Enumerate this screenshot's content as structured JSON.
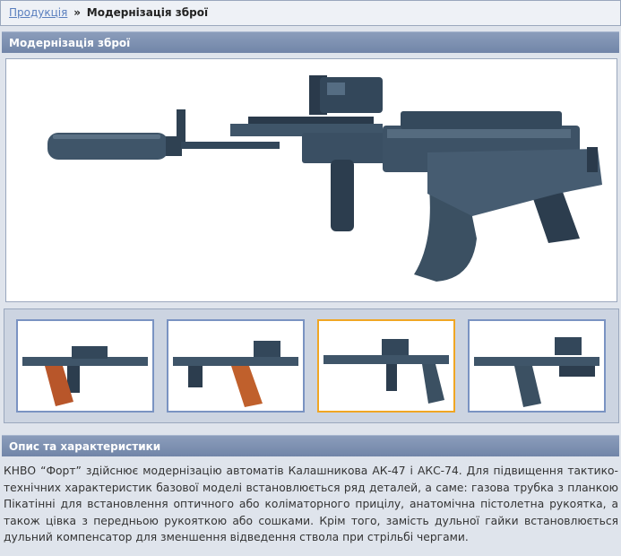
{
  "breadcrumb": {
    "link_label": "Продукція",
    "separator": "»",
    "current": "Модернізація зброї"
  },
  "section_title": "Модернізація зброї",
  "main_image": {
    "icon": "rifle-image",
    "alt": "Модернізована гвинтівка",
    "colors": {
      "metal": "#3f5569",
      "dark": "#253444",
      "highlight": "#6e8397"
    }
  },
  "gallery": {
    "thumbnails": [
      {
        "icon": "rifle-thumb",
        "magazine_color": "#b8562a",
        "active": false
      },
      {
        "icon": "rifle-thumb",
        "magazine_color": "#c0602c",
        "active": false
      },
      {
        "icon": "rifle-thumb",
        "magazine_color": "#3b5062",
        "active": true
      },
      {
        "icon": "rifle-thumb",
        "magazine_color": "#3b5062",
        "active": false
      }
    ],
    "active_border_color": "#f0a624",
    "border_color": "#7a93c2"
  },
  "description_title": "Опис та характеристики",
  "description_text": "КНВО “Форт” здійснює модернізацію автоматів Калашникова АК-47 і АКС-74. Для підвищення тактико-технічних характеристик базової моделі встановлюється ряд деталей, а саме: газова трубка з планкою Пікатінні для встановлення оптичного або коліматорного прицілу, анатомічна пістолетна рукоятка, а також цівка з передньою рукояткою або сошками. Крім того, замість дульної гайки встановлюється дульний компенсатор для зменшення відведення ствола при стрільбі чергами."
}
